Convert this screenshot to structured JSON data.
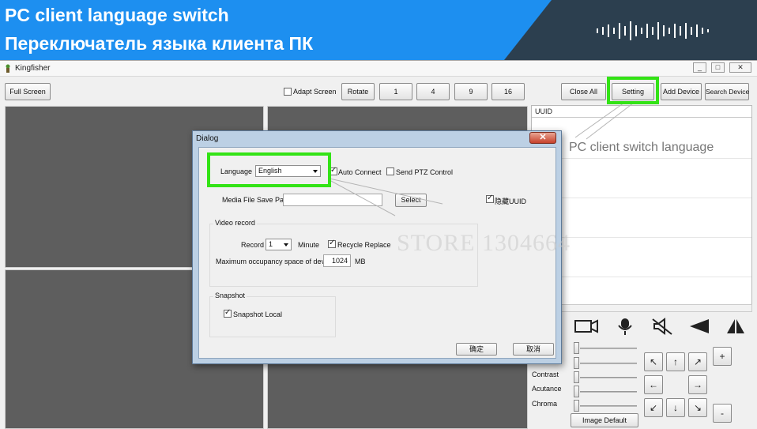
{
  "banner": {
    "title_en": "PC client language switch",
    "title_ru": "Переключатель языка клиента ПК"
  },
  "app": {
    "title": "Kingfisher",
    "window_controls": [
      "_",
      "□",
      "✕"
    ],
    "toolbar": {
      "full_screen": "Full Screen",
      "adapt_screen": "Adapt Screen",
      "rotate": "Rotate",
      "split_1": "1",
      "split_4": "4",
      "split_9": "9",
      "split_16": "16",
      "close_all": "Close All",
      "setting": "Setting",
      "add_device": "Add Device",
      "search_device": "Search Device"
    },
    "device_list": {
      "header": "UUID"
    },
    "image_controls": {
      "contrast": "Contrast",
      "acutance": "Acutance",
      "chroma": "Chroma",
      "image_default": "Image Default",
      "slider_levels": [
        0,
        0,
        0,
        0,
        0,
        0
      ]
    },
    "ptz": {
      "icons": [
        "camera-icon",
        "microphone-icon",
        "speaker-mute-icon",
        "zoom-in-icon",
        "zoom-out-icon"
      ],
      "dirs": [
        "↖",
        "↑",
        "↗",
        "←",
        "→",
        "↙",
        "↓",
        "↘"
      ],
      "plus": "+",
      "minus": "-"
    }
  },
  "dialog": {
    "title": "Dialog",
    "language_label": "Language",
    "language_value": "English",
    "auto_connect": "Auto Connect",
    "auto_connect_checked": true,
    "send_ptz": "Send PTZ Control",
    "send_ptz_checked": false,
    "media_path_label": "Media File Save Path",
    "media_path_value": "",
    "select_button": "Select",
    "hide_uuid": "隐藏UUID",
    "hide_uuid_checked": true,
    "video_record": {
      "title": "Video record",
      "record_label": "Record",
      "record_value": "1",
      "minute_label": "Minute",
      "recycle_replace": "Recycle Replace",
      "recycle_checked": true,
      "max_space_label": "Maximum occupancy space of device",
      "max_space_value": "1024",
      "mb_label": "MB"
    },
    "snapshot": {
      "title": "Snapshot",
      "snapshot_local": "Snapshot Local",
      "checked": true
    },
    "ok_button": "确定",
    "cancel_button": "取消"
  },
  "annotation": {
    "text": "PC client switch language",
    "watermark": "STORE 1304664",
    "highlight_color": "#33e316"
  }
}
